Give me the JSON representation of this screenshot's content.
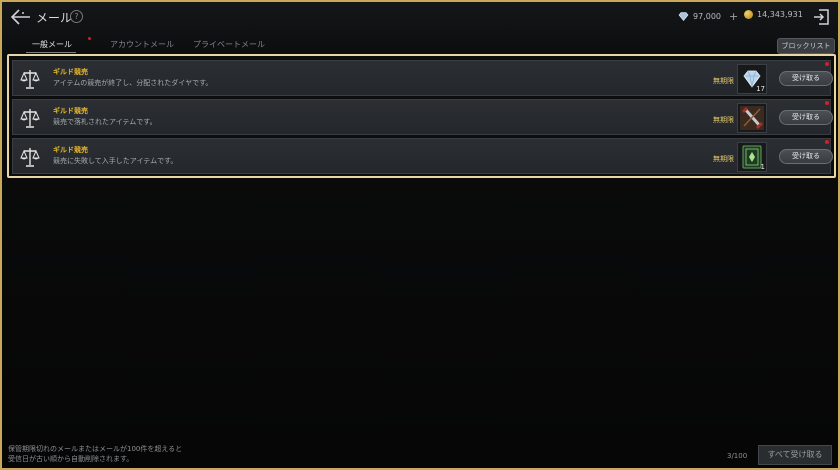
{
  "header": {
    "title": "メール",
    "help": "?",
    "diamonds": "97,000",
    "plus": "+",
    "gold": "14,343,931"
  },
  "tabs": [
    {
      "label": "一般メール",
      "active": true
    },
    {
      "label": "アカウントメール",
      "active": false
    },
    {
      "label": "プライベートメール",
      "active": false
    }
  ],
  "block_list_label": "ブロックリスト",
  "mails": [
    {
      "sender": "ギルド競売",
      "message": "アイテムの競売が終了し、分配されたダイヤです。",
      "expiry": "無期限",
      "item_icon": "diamond-icon",
      "quantity": "17",
      "receive_label": "受け取る"
    },
    {
      "sender": "ギルド競売",
      "message": "競売で落札されたアイテムです。",
      "expiry": "無期限",
      "item_icon": "weapon-icon",
      "quantity": "",
      "receive_label": "受け取る"
    },
    {
      "sender": "ギルド競売",
      "message": "競売に失敗して入手したアイテムです。",
      "expiry": "無期限",
      "item_icon": "spellbook-icon",
      "quantity": "1",
      "receive_label": "受け取る"
    }
  ],
  "footer": {
    "note_line1": "保管期限切れのメールまたはメールが100件を超えると",
    "note_line2": "受信日が古い順から自動削除されます。",
    "count": "3/100",
    "receive_all_label": "すべて受け取る"
  },
  "colors": {
    "accent_gold": "#e4b52c",
    "frame": "#c9a85a",
    "selection_border": "#e8d6a4",
    "unread_dot": "#d21f28"
  }
}
